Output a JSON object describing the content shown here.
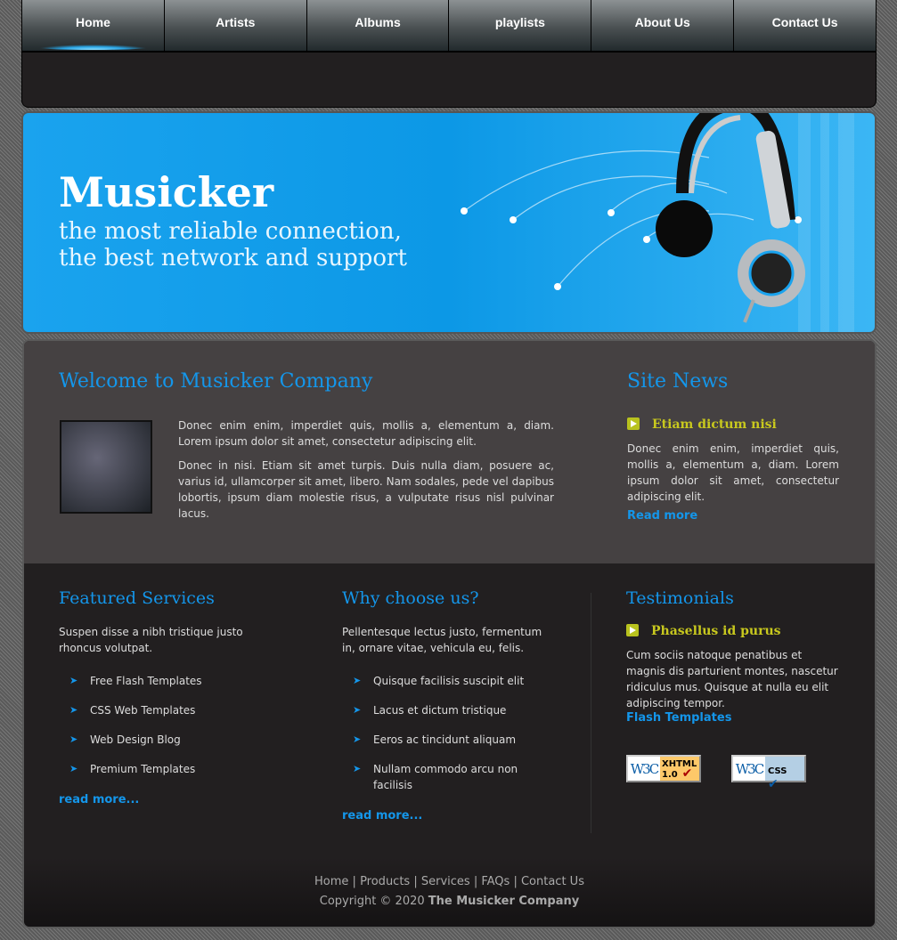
{
  "nav": [
    "Home",
    "Artists",
    "Albums",
    "playlists",
    "About Us",
    "Contact Us"
  ],
  "banner": {
    "title": "Musicker",
    "tagline1": "the most reliable connection,",
    "tagline2": "the best network and support"
  },
  "welcome": {
    "title": "Welcome to Musicker Company",
    "p1": "Donec enim enim, imperdiet quis, mollis a, elementum a, diam. Lorem ipsum dolor sit amet, consectetur adipiscing elit.",
    "p2": "Donec in nisi. Etiam sit amet turpis. Duis nulla diam, posuere ac, varius id, ullamcorper sit amet, libero. Nam sodales, pede vel dapibus lobortis, ipsum diam molestie risus, a vulputate risus nisl pulvinar lacus."
  },
  "news": {
    "title": "Site News",
    "item_title": "Etiam dictum nisi",
    "text": "Donec enim enim, imperdiet quis, mollis a, elementum a, diam. Lorem ipsum dolor sit amet, consectetur adipiscing elit.",
    "more": "Read more"
  },
  "services": {
    "title": "Featured Services",
    "intro": "Suspen disse a nibh tristique justo rhoncus volutpat.",
    "items": [
      "Free Flash Templates",
      "CSS Web Templates",
      "Web Design Blog",
      "Premium Templates"
    ],
    "more": "read more..."
  },
  "why": {
    "title": "Why choose us?",
    "intro": "Pellentesque lectus justo, fermentum in, ornare vitae, vehicula eu, felis.",
    "items": [
      "Quisque facilisis suscipit elit",
      "Lacus et dictum tristique",
      "Eeros ac tincidunt aliquam",
      "Nullam commodo arcu non facilisis"
    ],
    "more": "read more..."
  },
  "testimonials": {
    "title": "Testimonials",
    "item_title": "Phasellus id purus",
    "text": "Cum sociis natoque penatibus et magnis dis parturient montes, nascetur ridiculus mus. Quisque at nulla eu elit adipiscing tempor.",
    "link": "Flash Templates"
  },
  "badges": {
    "w3c": "W3C",
    "xhtml": "XHTML",
    "xhtml_ver": "1.0",
    "css": "CSS"
  },
  "footer": {
    "links": [
      "Home",
      "Products",
      "Services",
      "FAQs",
      "Contact Us"
    ],
    "copyright": "Copyright © 2020",
    "company": "The Musicker Company"
  }
}
